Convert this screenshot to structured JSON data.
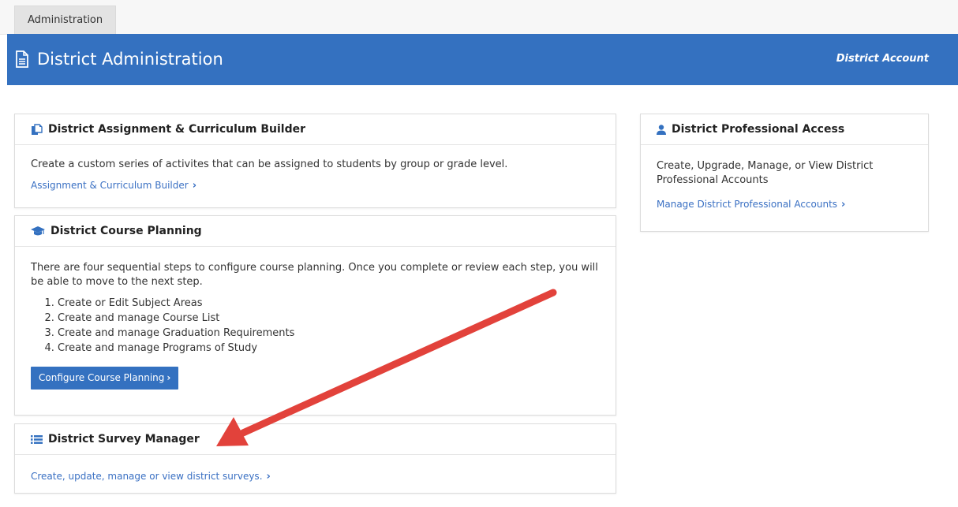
{
  "tabs": [
    {
      "label": "Administration"
    }
  ],
  "header": {
    "title": "District Administration",
    "account": "District Account"
  },
  "cards": {
    "assignment": {
      "title": "District Assignment & Curriculum Builder",
      "description": "Create a custom series of activites that can be assigned to students by group or grade level.",
      "link": "Assignment & Curriculum Builder"
    },
    "course_planning": {
      "title": "District Course Planning",
      "description": "There are four sequential steps to configure course planning. Once you complete or review each step, you will be able to move to the next step.",
      "steps": [
        "Create or Edit Subject Areas",
        "Create and manage Course List",
        "Create and manage Graduation Requirements",
        "Create and manage Programs of Study"
      ],
      "button": "Configure Course Planning"
    },
    "survey": {
      "title": "District Survey Manager",
      "link": "Create, update, manage or view district surveys."
    },
    "professional": {
      "title": "District Professional Access",
      "description": "Create, Upgrade, Manage, or View District Professional Accounts",
      "link": "Manage District Professional Accounts"
    }
  },
  "colors": {
    "primary": "#3471c0",
    "link": "#3a70c3",
    "annotation_arrow": "#e2423b"
  },
  "icons": {
    "header": "document-icon",
    "assignment": "copy-icon",
    "course_planning": "graduation-cap-icon",
    "survey": "list-icon",
    "professional": "user-icon",
    "chevron": "chevron-right-icon"
  }
}
